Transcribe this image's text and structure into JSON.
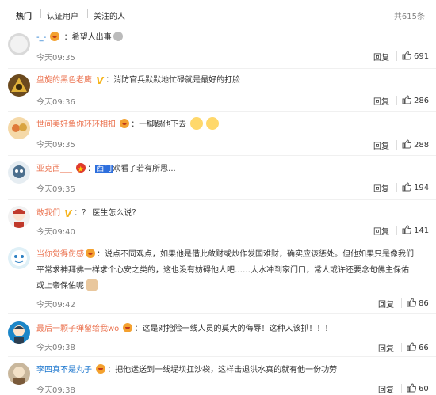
{
  "tabs": [
    {
      "label": "热门"
    },
    {
      "label": "认证用户"
    },
    {
      "label": "关注的人"
    }
  ],
  "total_text": "共615条",
  "reply_label": "回复",
  "comments": [
    {
      "user": "-_-",
      "text": "希望人出事",
      "time": "今天09:35",
      "likes": "691"
    },
    {
      "user": "盘旋的黑色老鹰",
      "text": "：消防官兵默默地忙碌就是最好的打脸",
      "time": "今天09:36",
      "likes": "286"
    },
    {
      "user": "世间美好鱼你环环相扣",
      "text": "：一脚踢他下去",
      "time": "今天09:35",
      "likes": "288"
    },
    {
      "user": "亚克西___",
      "text_hl": "西门",
      "text_hl2": "欢",
      "text": "看了若有所思...",
      "time": "今天09:35",
      "likes": "194"
    },
    {
      "user": "敢我们",
      "text": "：？ 医生怎么说？",
      "time": "今天09:40",
      "likes": "141"
    },
    {
      "user": "当你觉得伤感",
      "line1": "：说点不同观点，如果他是借此敛财或炒作发国难财，确实应该惩处。但他如果只是像我们",
      "line2": "平常求神拜佛一样求个心安之类的，这也没有妨碍他人吧……大水冲到家门口，常人或许还要念句佛主保佑",
      "line3": "或上帝保佑呢",
      "time": "今天09:42",
      "likes": "86"
    },
    {
      "user": "最后一颗子弹留给我wo",
      "text": "：这是对抢险一线人员的莫大的侮辱！这种人该抓！！！",
      "time": "今天09:38",
      "likes": "66"
    },
    {
      "user": "李四真不是丸子",
      "text": "：把他运送到一线堤坝扛沙袋，这样击退洪水真的就有他一份功劳",
      "time": "今天09:38",
      "likes": "60"
    }
  ]
}
